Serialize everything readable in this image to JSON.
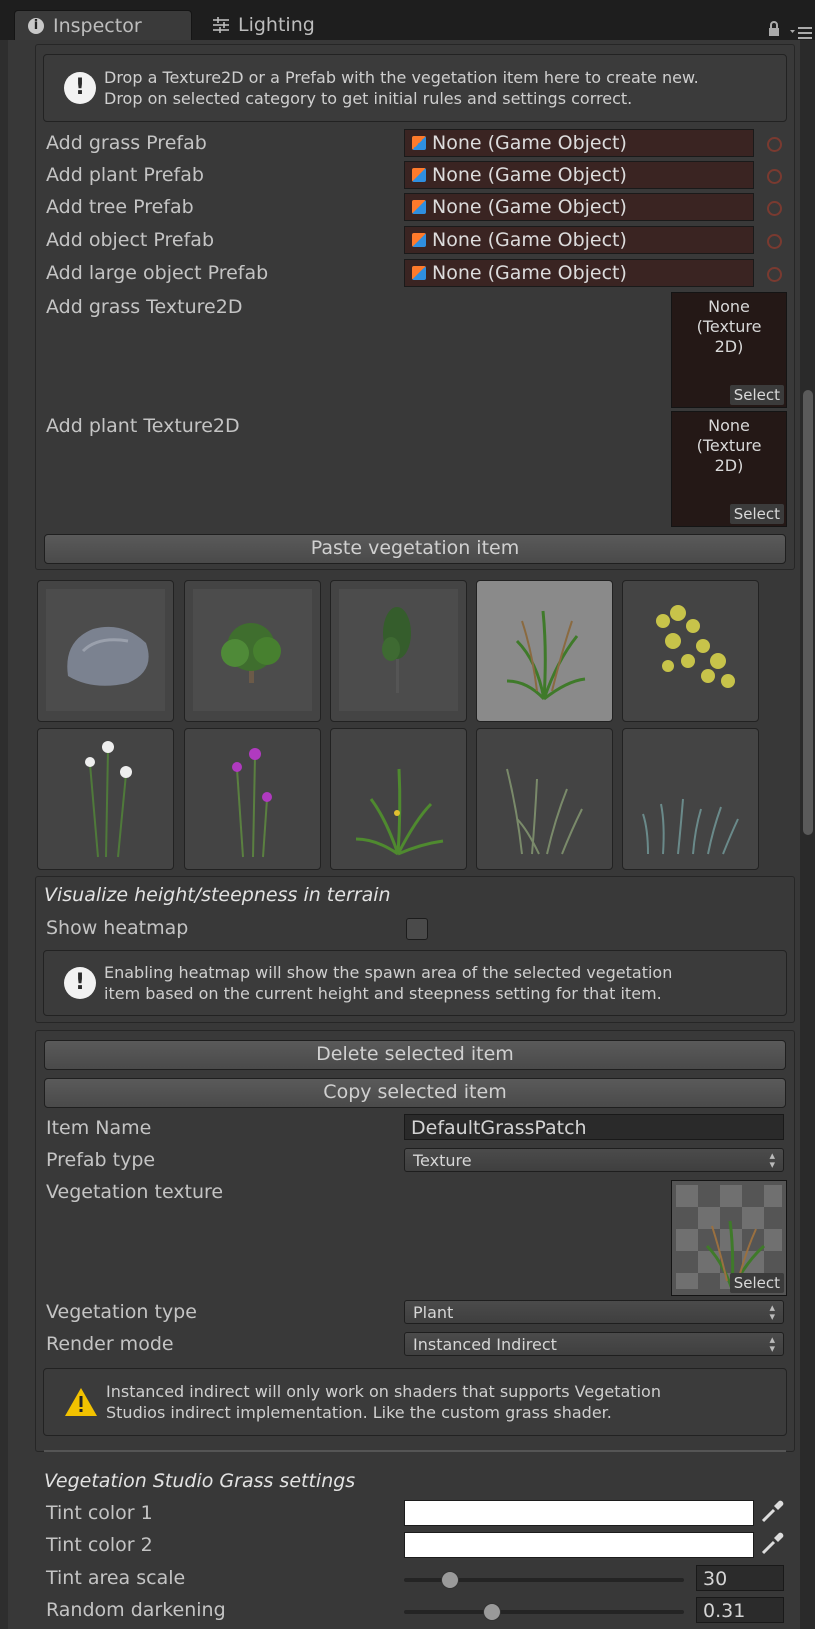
{
  "tabs": {
    "inspector": "Inspector",
    "lighting": "Lighting"
  },
  "header_help": {
    "line1": "Drop a Texture2D or a Prefab with the vegetation item here to create new.",
    "line2": "Drop on selected category to get initial rules and settings correct."
  },
  "add_prefab_rows": [
    {
      "label": "Add grass Prefab",
      "value": "None (Game Object)"
    },
    {
      "label": "Add plant Prefab",
      "value": "None (Game Object)"
    },
    {
      "label": "Add tree Prefab",
      "value": "None (Game Object)"
    },
    {
      "label": "Add object Prefab",
      "value": "None (Game Object)"
    },
    {
      "label": "Add large object Prefab",
      "value": "None (Game Object)"
    }
  ],
  "add_texture_rows": [
    {
      "label": "Add grass Texture2D",
      "slot_line1": "None",
      "slot_line2": "(Texture",
      "slot_line3": "2D)",
      "select": "Select"
    },
    {
      "label": "Add plant Texture2D",
      "slot_line1": "None",
      "slot_line2": "(Texture",
      "slot_line3": "2D)",
      "select": "Select"
    }
  ],
  "paste_button": "Paste vegetation item",
  "thumbnails": [
    {
      "icon": "rock-icon",
      "selected": false
    },
    {
      "icon": "bush-tree-icon",
      "selected": false
    },
    {
      "icon": "tall-tree-icon",
      "selected": false
    },
    {
      "icon": "grass-patch-icon",
      "selected": true
    },
    {
      "icon": "yellow-plant-icon",
      "selected": false
    },
    {
      "icon": "daisy-flowers-icon",
      "selected": false
    },
    {
      "icon": "purple-flowers-icon",
      "selected": false
    },
    {
      "icon": "green-grass-icon",
      "selected": false
    },
    {
      "icon": "dry-grass-icon",
      "selected": false
    },
    {
      "icon": "blue-grass-icon",
      "selected": false
    }
  ],
  "heatmap": {
    "title": "Visualize height/steepness in terrain",
    "show_label": "Show heatmap",
    "checked": false,
    "help_line1": "Enabling heatmap will show the spawn area of the selected vegetation",
    "help_line2": "item based on the current height and steepness setting for that item."
  },
  "item": {
    "delete_button": "Delete selected item",
    "copy_button": "Copy selected item",
    "name_label": "Item Name",
    "name_value": "DefaultGrassPatch",
    "prefab_type_label": "Prefab type",
    "prefab_type_value": "Texture",
    "texture_label": "Vegetation texture",
    "texture_select": "Select",
    "veg_type_label": "Vegetation type",
    "veg_type_value": "Plant",
    "render_mode_label": "Render mode",
    "render_mode_value": "Instanced Indirect",
    "warn_line1": "Instanced indirect will only work on shaders that supports Vegetation",
    "warn_line2": "Studios indirect implementation. Like the custom grass shader."
  },
  "grass_settings": {
    "title": "Vegetation Studio Grass settings",
    "tint1_label": "Tint color 1",
    "tint1_color": "#ffffff",
    "tint2_label": "Tint color 2",
    "tint2_color": "#ffffff",
    "tint_scale_label": "Tint area scale",
    "tint_scale_value": "30",
    "tint_scale_fraction": 0.16,
    "random_dark_label": "Random darkening",
    "random_dark_value": "0.31",
    "random_dark_fraction": 0.31
  }
}
